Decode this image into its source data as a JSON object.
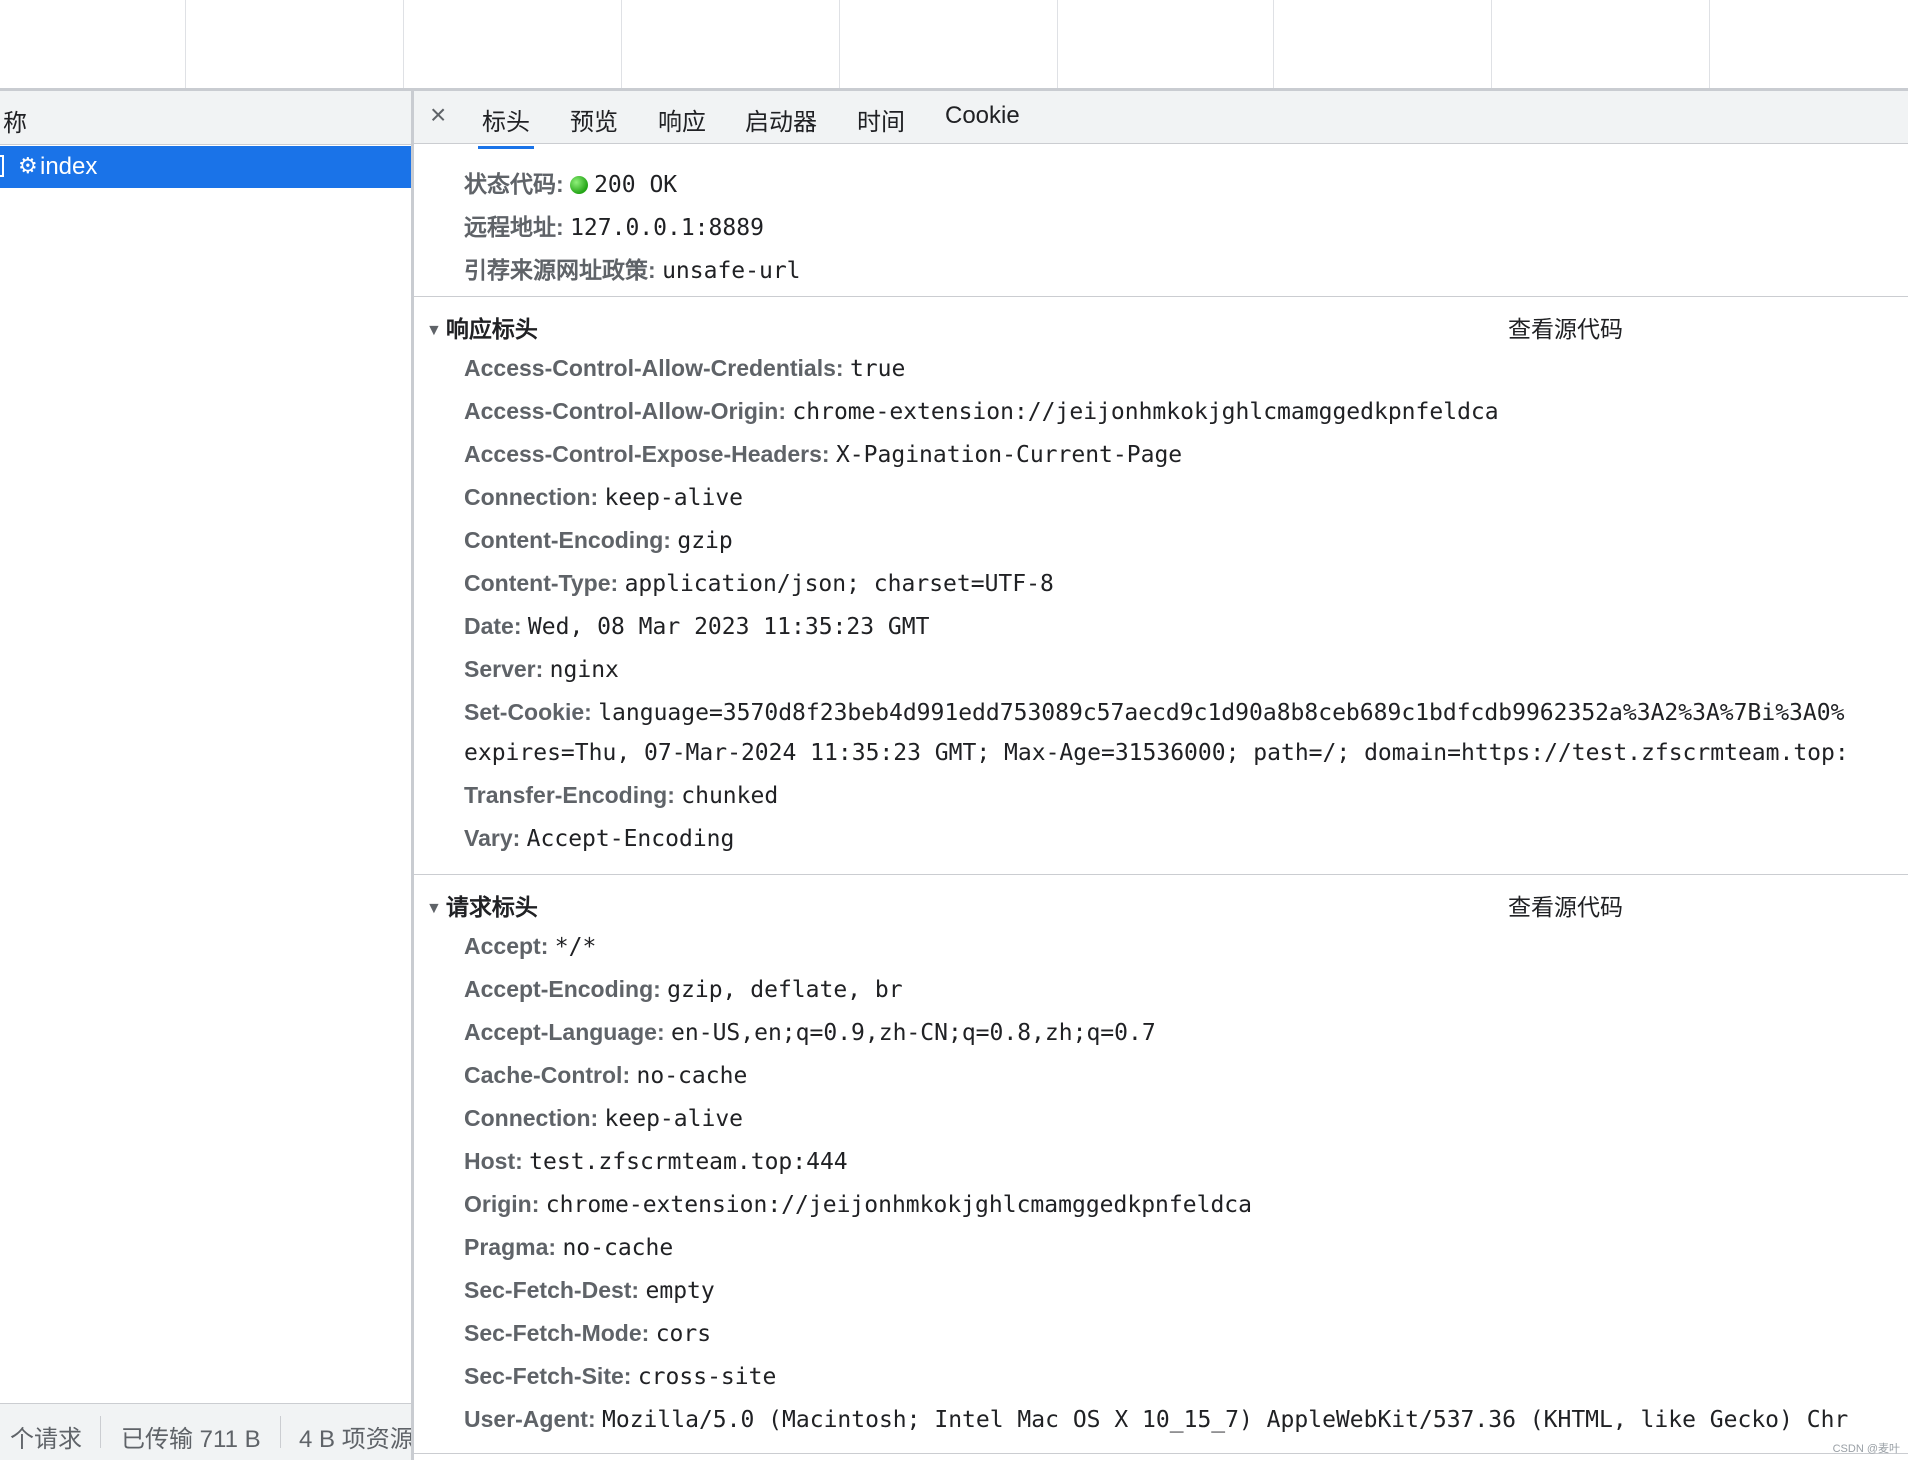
{
  "left": {
    "header": "称",
    "request_name": "index",
    "status": [
      "个请求",
      "已传输 711 B",
      "4 B 项资源"
    ]
  },
  "tabs": [
    "标头",
    "预览",
    "响应",
    "启动器",
    "时间",
    "Cookie"
  ],
  "general": {
    "rows": [
      {
        "k": "状态代码:",
        "v": "200 OK"
      },
      {
        "k": "远程地址:",
        "v": "127.0.0.1:8889"
      },
      {
        "k": "引荐来源网址政策:",
        "v": "unsafe-url"
      }
    ]
  },
  "response_headers": {
    "title": "响应标头",
    "view_source": "查看源代码",
    "rows": [
      {
        "k": "Access-Control-Allow-Credentials:",
        "v": "true"
      },
      {
        "k": "Access-Control-Allow-Origin:",
        "v": "chrome-extension://jeijonhmkokjghlcmamggedkpnfeldca"
      },
      {
        "k": "Access-Control-Expose-Headers:",
        "v": "X-Pagination-Current-Page"
      },
      {
        "k": "Connection:",
        "v": "keep-alive"
      },
      {
        "k": "Content-Encoding:",
        "v": "gzip"
      },
      {
        "k": "Content-Type:",
        "v": "application/json; charset=UTF-8"
      },
      {
        "k": "Date:",
        "v": "Wed, 08 Mar 2023 11:35:23 GMT"
      },
      {
        "k": "Server:",
        "v": "nginx"
      },
      {
        "k": "Set-Cookie:",
        "v": "language=3570d8f23beb4d991edd753089c57aecd9c1d90a8b8ceb689c1bdfcdb9962352a%3A2%3A%7Bi%3A0%"
      },
      {
        "k": "",
        "v": "expires=Thu, 07-Mar-2024 11:35:23 GMT; Max-Age=31536000; path=/; domain=https://test.zfscrmteam.top:"
      },
      {
        "k": "Transfer-Encoding:",
        "v": "chunked"
      },
      {
        "k": "Vary:",
        "v": "Accept-Encoding"
      }
    ]
  },
  "request_headers": {
    "title": "请求标头",
    "view_source": "查看源代码",
    "rows": [
      {
        "k": "Accept:",
        "v": "*/*"
      },
      {
        "k": "Accept-Encoding:",
        "v": "gzip, deflate, br"
      },
      {
        "k": "Accept-Language:",
        "v": "en-US,en;q=0.9,zh-CN;q=0.8,zh;q=0.7"
      },
      {
        "k": "Cache-Control:",
        "v": "no-cache"
      },
      {
        "k": "Connection:",
        "v": "keep-alive"
      },
      {
        "k": "Host:",
        "v": "test.zfscrmteam.top:444"
      },
      {
        "k": "Origin:",
        "v": "chrome-extension://jeijonhmkokjghlcmamggedkpnfeldca"
      },
      {
        "k": "Pragma:",
        "v": "no-cache"
      },
      {
        "k": "Sec-Fetch-Dest:",
        "v": "empty"
      },
      {
        "k": "Sec-Fetch-Mode:",
        "v": "cors"
      },
      {
        "k": "Sec-Fetch-Site:",
        "v": "cross-site"
      },
      {
        "k": "User-Agent:",
        "v": "Mozilla/5.0 (Macintosh; Intel Mac OS X 10_15_7) AppleWebKit/537.36 (KHTML, like Gecko) Chr"
      }
    ]
  },
  "watermark": "CSDN @麦叶",
  "icons": {
    "close": "close-icon",
    "gear": "gear-icon",
    "status": "status-dot-icon",
    "expand": "triangle-down-icon"
  },
  "colors": {
    "accent": "#1a73e8",
    "status_ok": "#23a415"
  }
}
